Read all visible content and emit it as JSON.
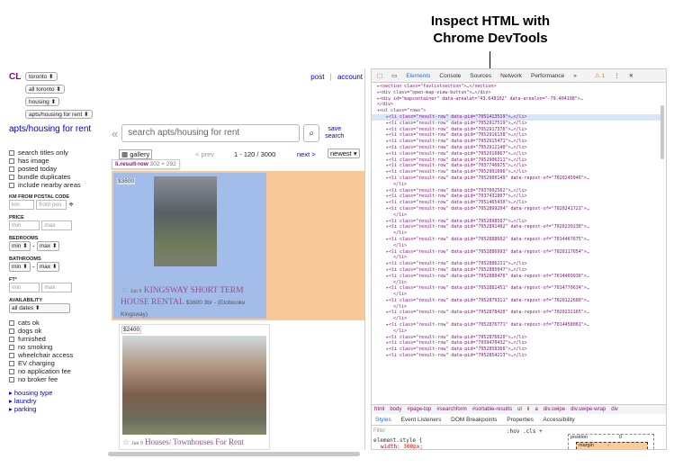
{
  "caption": {
    "line1": "Inspect HTML with",
    "line2": "Chrome DevTools"
  },
  "cl": {
    "logo": "CL",
    "selects": [
      "toronto",
      "all toronto",
      "housing",
      "apts/housing for rent"
    ],
    "toplinks": [
      "post",
      "account"
    ],
    "sidebar": {
      "title": "apts/housing for rent",
      "options": [
        "search titles only",
        "has image",
        "posted today",
        "bundle duplicates",
        "include nearby areas"
      ],
      "km_label": "KM FROM POSTAL CODE",
      "km_placeholder": "km",
      "from_placeholder": "from pos",
      "price_label": "PRICE",
      "min": "min",
      "max": "max",
      "bedrooms_label": "BEDROOMS",
      "bathrooms_label": "BATHROOMS",
      "ft_label": "FT²",
      "availability_label": "AVAILABILITY",
      "availability_value": "all dates",
      "pets": [
        "cats ok",
        "dogs ok",
        "furnished",
        "no smoking",
        "wheelchair access",
        "EV charging",
        "no application fee",
        "no broker fee"
      ],
      "links": [
        "housing type",
        "laundry",
        "parking"
      ],
      "dash": "-"
    },
    "search": {
      "placeholder": "search apts/housing for rent",
      "save_label_1": "save",
      "save_label_2": "search"
    },
    "pager": {
      "gallery": "gallery",
      "prev": "< prev",
      "range": "1 - 120 / 3000",
      "next": "next >",
      "sort": "newest"
    },
    "tooltip": {
      "selector": "li.result-row",
      "size": "302 × 292"
    },
    "listings": [
      {
        "price": "$3600",
        "date": "Jan 9",
        "title": "KINGSWAY SHORT TERM HOUSE RENTAL",
        "details": "$3600 3br - (Etobicoke Kingsway)"
      },
      {
        "price": "$2400",
        "date": "Jan 9",
        "title": "Houses/ Townhouses For Rent"
      }
    ]
  },
  "devtools": {
    "tabs": [
      "Elements",
      "Console",
      "Sources",
      "Network",
      "Performance",
      "»"
    ],
    "warn": "⚠ 1",
    "code_lines": [
      {
        "t": "▸<section class=\"favlistsection\">…</section>"
      },
      {
        "t": "▸<div class=\"open-map-view-button\">…</div>"
      },
      {
        "t": "▸<div id=\"mapcontainer\" data-arealat=\"43.648102\" data-arealon=\"-79.404198\">…"
      },
      {
        "t": "</div>"
      },
      {
        "t": "▾<ul class=\"rows\">"
      },
      {
        "t": "▸<li class=\"result-row\" data-pid=\"7051413519\">…</li>",
        "sel": true
      },
      {
        "t": "▸<li class=\"result-row\" data-pid=\"7052917519\">…</li>"
      },
      {
        "t": "▸<li class=\"result-row\" data-pid=\"7052917376\">…</li>"
      },
      {
        "t": "▸<li class=\"result-row\" data-pid=\"7052916138\">…</li>"
      },
      {
        "t": "▸<li class=\"result-row\" data-pid=\"7052915471\">…</li>"
      },
      {
        "t": "▸<li class=\"result-row\" data-pid=\"7052912140\">…</li>"
      },
      {
        "t": "▸<li class=\"result-row\" data-pid=\"7052910867\">…</li>"
      },
      {
        "t": "▸<li class=\"result-row\" data-pid=\"7052906211\">…</li>"
      },
      {
        "t": "▸<li class=\"result-row\" data-pid=\"7037746075\">…</li>"
      },
      {
        "t": "▸<li class=\"result-row\" data-pid=\"7052901096\">…</li>"
      },
      {
        "t": "▸<li class=\"result-row\" data-pid=\"7052900149\" data-repost-of=\"7020245046\">…"
      },
      {
        "t": "</li>"
      },
      {
        "t": "▸<li class=\"result-row\" data-pid=\"7037002562\">…</li>"
      },
      {
        "t": "▸<li class=\"result-row\" data-pid=\"7037431807\">…</li>"
      },
      {
        "t": "▸<li class=\"result-row\" data-pid=\"7051465430\">…</li>"
      },
      {
        "t": "▸<li class=\"result-row\" data-pid=\"7052899204\" data-repost-of=\"7020241721\">…"
      },
      {
        "t": "</li>"
      },
      {
        "t": "▸<li class=\"result-row\" data-pid=\"7052898507\">…</li>"
      },
      {
        "t": "▸<li class=\"result-row\" data-pid=\"7052891402\" data-repost-of=\"7020230238\">…"
      },
      {
        "t": "</li>"
      },
      {
        "t": "▸<li class=\"result-row\" data-pid=\"7052888602\" data-repost-of=\"7014467675\">…"
      },
      {
        "t": "</li>"
      },
      {
        "t": "▸<li class=\"result-row\" data-pid=\"7052886993\" data-repost-of=\"7020117654\">…"
      },
      {
        "t": "</li>"
      },
      {
        "t": "▸<li class=\"result-row\" data-pid=\"7052886231\">…</li>"
      },
      {
        "t": "▸<li class=\"result-row\" data-pid=\"7052885047\">…</li>"
      },
      {
        "t": "▸<li class=\"result-row\" data-pid=\"7052880476\" data-repost-of=\"7014469936\">…"
      },
      {
        "t": "</li>"
      },
      {
        "t": "▸<li class=\"result-row\" data-pid=\"7052881451\" data-repost-of=\"7014770634\">…"
      },
      {
        "t": "</li>"
      },
      {
        "t": "▸<li class=\"result-row\" data-pid=\"7052879311\" data-repost-of=\"7020122680\">…"
      },
      {
        "t": "</li>"
      },
      {
        "t": "▸<li class=\"result-row\" data-pid=\"7052878420\" data-repost-of=\"7020232165\">…"
      },
      {
        "t": "</li>"
      },
      {
        "t": "▸<li class=\"result-row\" data-pid=\"7052876771\" data-repost-of=\"7014458061\">…"
      },
      {
        "t": "</li>"
      },
      {
        "t": "▸<li class=\"result-row\" data-pid=\"7052876620\">…</li>"
      },
      {
        "t": "▸<li class=\"result-row\" data-pid=\"7039470432\">…</li>"
      },
      {
        "t": "▸<li class=\"result-row\" data-pid=\"7052858366\">…</li>"
      },
      {
        "t": "▸<li class=\"result-row\" data-pid=\"7052854213\">…</li>"
      }
    ],
    "breadcrumb": [
      "html",
      "body",
      "#page-top",
      "#searchform",
      "#sortable-results",
      "ul",
      "li",
      "a",
      "div.swipe",
      "div.swipe-wrap",
      "div"
    ],
    "subtabs": [
      "Styles",
      "Event Listeners",
      "DOM Breakpoints",
      "Properties",
      "Accessibility"
    ],
    "filter_placeholder": "Filter",
    "hov_cls": ":hov .cls +",
    "element_style": "element.style {",
    "width_rule": "width: 300px;",
    "position_label": "position",
    "position_value": "0",
    "margin_label": "margin",
    "margin_value": "-"
  }
}
